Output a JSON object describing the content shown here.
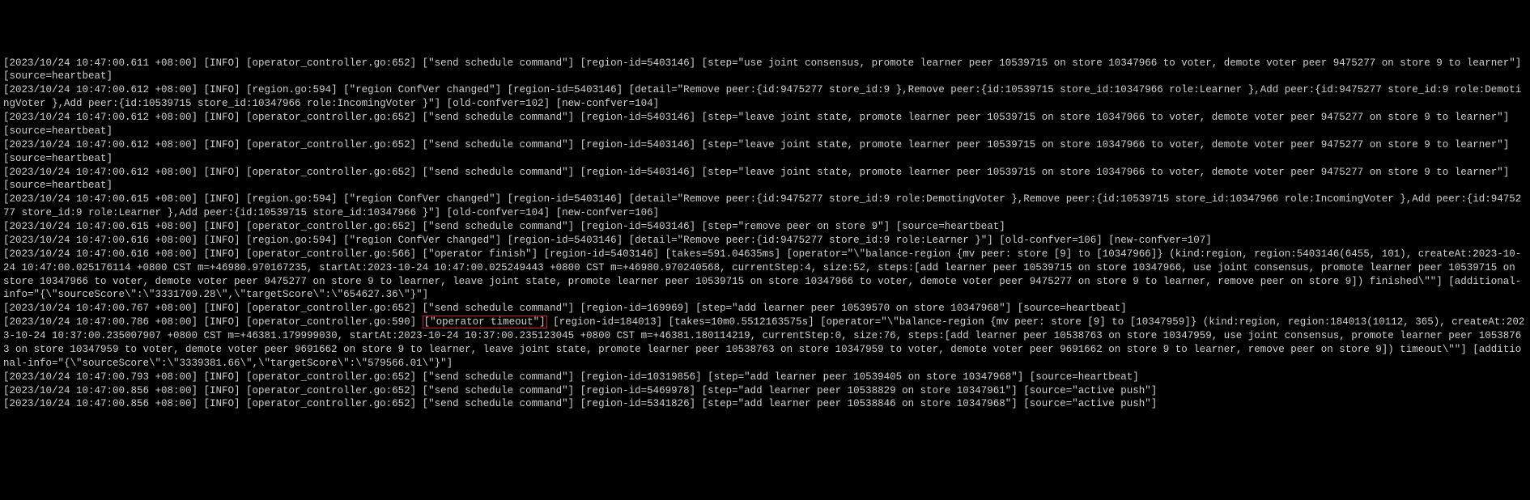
{
  "logs": [
    {
      "text": "[2023/10/24 10:47:00.611 +08:00] [INFO] [operator_controller.go:652] [\"send schedule command\"] [region-id=5403146] [step=\"use joint consensus, promote learner peer 10539715 on store 10347966 to voter, demote voter peer 9475277 on store 9 to learner\"] [source=heartbeat]"
    },
    {
      "text": "[2023/10/24 10:47:00.612 +08:00] [INFO] [region.go:594] [\"region ConfVer changed\"] [region-id=5403146] [detail=\"Remove peer:{id:9475277 store_id:9 },Remove peer:{id:10539715 store_id:10347966 role:Learner },Add peer:{id:9475277 store_id:9 role:DemotingVoter },Add peer:{id:10539715 store_id:10347966 role:IncomingVoter }\"] [old-confver=102] [new-confver=104]"
    },
    {
      "text": "[2023/10/24 10:47:00.612 +08:00] [INFO] [operator_controller.go:652] [\"send schedule command\"] [region-id=5403146] [step=\"leave joint state, promote learner peer 10539715 on store 10347966 to voter, demote voter peer 9475277 on store 9 to learner\"] [source=heartbeat]"
    },
    {
      "text": "[2023/10/24 10:47:00.612 +08:00] [INFO] [operator_controller.go:652] [\"send schedule command\"] [region-id=5403146] [step=\"leave joint state, promote learner peer 10539715 on store 10347966 to voter, demote voter peer 9475277 on store 9 to learner\"] [source=heartbeat]"
    },
    {
      "text": "[2023/10/24 10:47:00.612 +08:00] [INFO] [operator_controller.go:652] [\"send schedule command\"] [region-id=5403146] [step=\"leave joint state, promote learner peer 10539715 on store 10347966 to voter, demote voter peer 9475277 on store 9 to learner\"] [source=heartbeat]"
    },
    {
      "text": "[2023/10/24 10:47:00.615 +08:00] [INFO] [region.go:594] [\"region ConfVer changed\"] [region-id=5403146] [detail=\"Remove peer:{id:9475277 store_id:9 role:DemotingVoter },Remove peer:{id:10539715 store_id:10347966 role:IncomingVoter },Add peer:{id:9475277 store_id:9 role:Learner },Add peer:{id:10539715 store_id:10347966 }\"] [old-confver=104] [new-confver=106]"
    },
    {
      "text": "[2023/10/24 10:47:00.615 +08:00] [INFO] [operator_controller.go:652] [\"send schedule command\"] [region-id=5403146] [step=\"remove peer on store 9\"] [source=heartbeat]"
    },
    {
      "text": "[2023/10/24 10:47:00.616 +08:00] [INFO] [region.go:594] [\"region ConfVer changed\"] [region-id=5403146] [detail=\"Remove peer:{id:9475277 store_id:9 role:Learner }\"] [old-confver=106] [new-confver=107]"
    },
    {
      "text": "[2023/10/24 10:47:00.616 +08:00] [INFO] [operator_controller.go:566] [\"operator finish\"] [region-id=5403146] [takes=591.04635ms] [operator=\"\\\"balance-region {mv peer: store [9] to [10347966]} (kind:region, region:5403146(6455, 101), createAt:2023-10-24 10:47:00.025176114 +0800 CST m=+46980.970167235, startAt:2023-10-24 10:47:00.025249443 +0800 CST m=+46980.970240568, currentStep:4, size:52, steps:[add learner peer 10539715 on store 10347966, use joint consensus, promote learner peer 10539715 on store 10347966 to voter, demote voter peer 9475277 on store 9 to learner, leave joint state, promote learner peer 10539715 on store 10347966 to voter, demote voter peer 9475277 on store 9 to learner, remove peer on store 9]) finished\\\"\"] [additional-info=\"{\\\"sourceScore\\\":\\\"3331709.28\\\",\\\"targetScore\\\":\\\"654627.36\\\"}\"]"
    },
    {
      "text": "[2023/10/24 10:47:00.767 +08:00] [INFO] [operator_controller.go:652] [\"send schedule command\"] [region-id=169969] [step=\"add learner peer 10539570 on store 10347968\"] [source=heartbeat]"
    },
    {
      "pre": "[2023/10/24 10:47:00.786 +08:00] [INFO] [operator_controller.go:590] ",
      "highlight": "[\"operator timeout\"]",
      "post": " [region-id=184013] [takes=10m0.5512163575s] [operator=\"\\\"balance-region {mv peer: store [9] to [10347959]} (kind:region, region:184013(10112, 365), createAt:2023-10-24 10:37:00.235007907 +0800 CST m=+46381.179999030, startAt:2023-10-24 10:37:00.235123045 +0800 CST m=+46381.180114219, currentStep:0, size:76, steps:[add learner peer 10538763 on store 10347959, use joint consensus, promote learner peer 10538763 on store 10347959 to voter, demote voter peer 9691662 on store 9 to learner, leave joint state, promote learner peer 10538763 on store 10347959 to voter, demote voter peer 9691662 on store 9 to learner, remove peer on store 9]) timeout\\\"\"] [additional-info=\"{\\\"sourceScore\\\":\\\"3339381.66\\\",\\\"targetScore\\\":\\\"579566.01\\\"}\"]"
    },
    {
      "text": "[2023/10/24 10:47:00.793 +08:00] [INFO] [operator_controller.go:652] [\"send schedule command\"] [region-id=10319856] [step=\"add learner peer 10539405 on store 10347968\"] [source=heartbeat]"
    },
    {
      "text": "[2023/10/24 10:47:00.856 +08:00] [INFO] [operator_controller.go:652] [\"send schedule command\"] [region-id=5469978] [step=\"add learner peer 10538829 on store 10347961\"] [source=\"active push\"]"
    },
    {
      "text": "[2023/10/24 10:47:00.856 +08:00] [INFO] [operator_controller.go:652] [\"send schedule command\"] [region-id=5341826] [step=\"add learner peer 10538846 on store 10347968\"] [source=\"active push\"]"
    }
  ]
}
